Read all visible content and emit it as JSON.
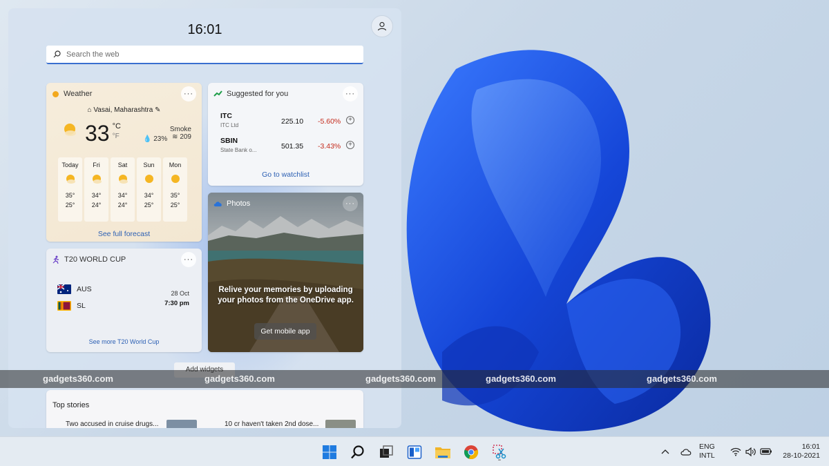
{
  "widgets": {
    "clock": "16:01",
    "search_placeholder": "Search the web",
    "weather": {
      "title": "Weather",
      "location": "Vasai, Maharashtra",
      "temp": "33",
      "unit_c": "°C",
      "unit_f": "°F",
      "humidity": "23%",
      "aqi_label": "Smoke",
      "aqi_value": "209",
      "forecast": [
        {
          "day": "Today",
          "hi": "35°",
          "lo": "25°",
          "icon": "partly-sunny-icon"
        },
        {
          "day": "Fri",
          "hi": "34°",
          "lo": "24°",
          "icon": "partly-sunny-icon"
        },
        {
          "day": "Sat",
          "hi": "34°",
          "lo": "24°",
          "icon": "partly-sunny-icon"
        },
        {
          "day": "Sun",
          "hi": "34°",
          "lo": "25°",
          "icon": "sun-icon"
        },
        {
          "day": "Mon",
          "hi": "35°",
          "lo": "25°",
          "icon": "sun-icon"
        }
      ],
      "link": "See full forecast"
    },
    "stocks": {
      "title": "Suggested for you",
      "items": [
        {
          "symbol": "ITC",
          "name": "ITC Ltd",
          "price": "225.10",
          "change": "-5.60%"
        },
        {
          "symbol": "SBIN",
          "name": "State Bank o...",
          "price": "501.35",
          "change": "-3.43%"
        }
      ],
      "link": "Go to watchlist"
    },
    "photos": {
      "title": "Photos",
      "message": "Relive your memories by uploading your photos from the OneDrive app.",
      "button": "Get mobile app"
    },
    "t20": {
      "title": "T20 WORLD CUP",
      "team1": "AUS",
      "team2": "SL",
      "date": "28 Oct",
      "time": "7:30 pm",
      "link": "See more T20 World Cup"
    },
    "add_widgets": "Add widgets",
    "top_stories": {
      "title": "Top stories",
      "items": [
        "Two accused in cruise drugs...",
        "10 cr haven't taken 2nd dose..."
      ]
    },
    "more_label": "···"
  },
  "watermark": "gadgets360.com",
  "taskbar": {
    "apps": [
      "start-icon",
      "search-icon",
      "task-view-icon",
      "widgets-icon",
      "file-explorer-icon",
      "chrome-icon",
      "snipping-tool-icon"
    ],
    "lang_line1": "ENG",
    "lang_line2": "INTL",
    "time": "16:01",
    "date": "28-10-2021"
  },
  "colors": {
    "accent": "#2b5fb3",
    "negative": "#c42b1c",
    "wallpaper_blue": "#1a4fd6"
  }
}
